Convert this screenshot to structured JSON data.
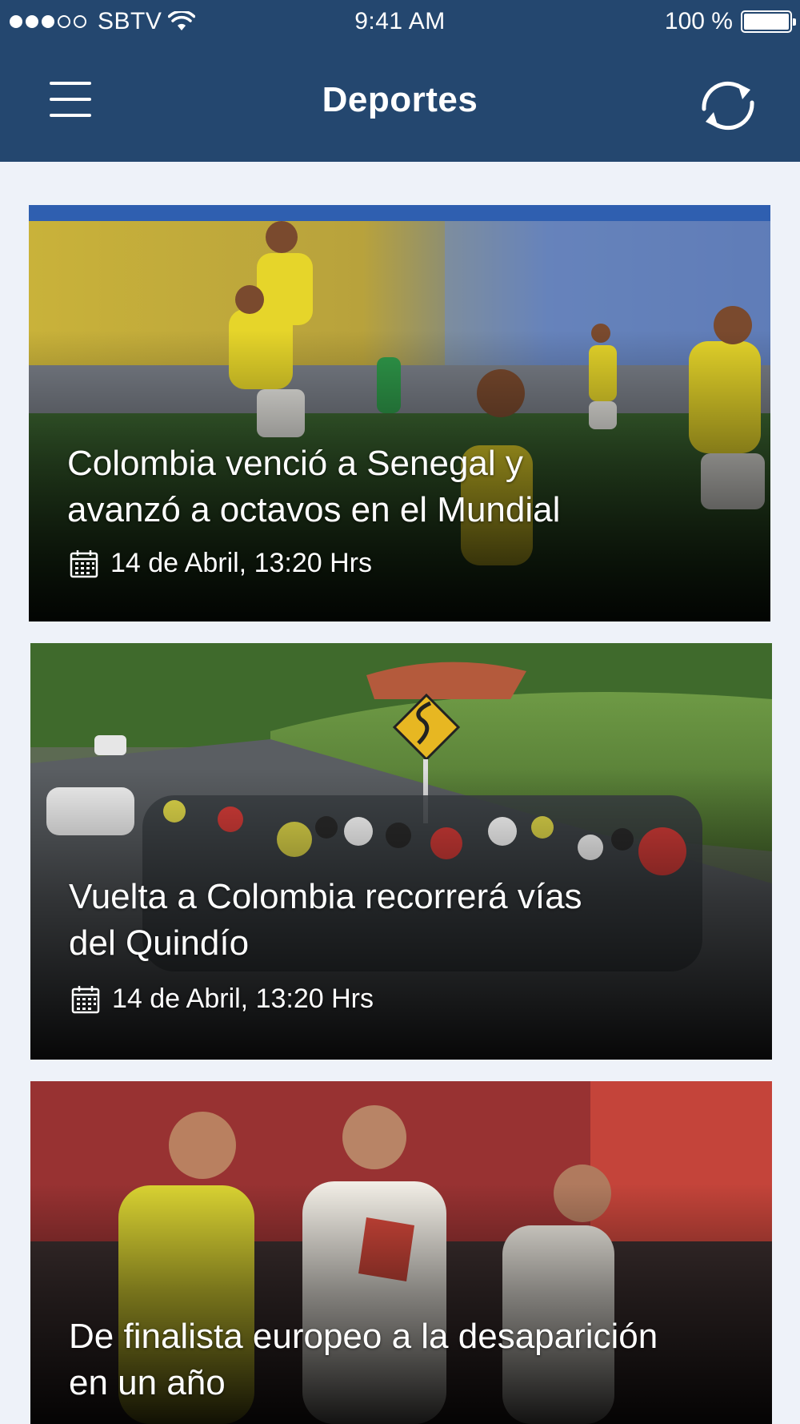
{
  "status_bar": {
    "carrier": "SBTV",
    "signal_bars_filled": 3,
    "signal_bars_total": 5,
    "time": "9:41 AM",
    "battery_text": "100 %",
    "battery_level": 1.0
  },
  "nav": {
    "title": "Deportes",
    "menu_icon": "hamburger-menu-icon",
    "refresh_icon": "refresh-icon"
  },
  "articles": [
    {
      "headline_line1": "Colombia venció a Senegal y",
      "headline_line2": "avanzó a octavos en el Mundial",
      "date": "14 de Abril, 13:20 Hrs",
      "image": "soccer-celebration-photo"
    },
    {
      "headline_line1": "Vuelta a Colombia recorrerá vías",
      "headline_line2": "del Quindío",
      "date": "14 de Abril, 13:20 Hrs",
      "image": "cycling-peloton-photo"
    },
    {
      "headline_line1": "De finalista europeo a la desaparición",
      "headline_line2": "en un año",
      "image": "spain-players-photo"
    }
  ],
  "colors": {
    "header": "#24476f",
    "background": "#eef2f9",
    "text_on_image": "#ffffff"
  }
}
